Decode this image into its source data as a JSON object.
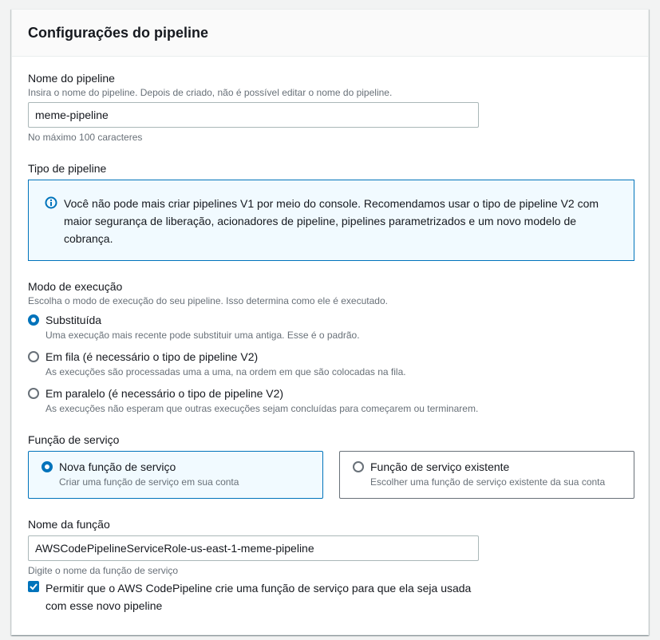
{
  "panel": {
    "title": "Configurações do pipeline"
  },
  "pipeline_name": {
    "label": "Nome do pipeline",
    "description": "Insira o nome do pipeline. Depois de criado, não é possível editar o nome do pipeline.",
    "value": "meme-pipeline",
    "constraint": "No máximo 100 caracteres"
  },
  "pipeline_type": {
    "label": "Tipo de pipeline",
    "info_text": "Você não pode mais criar pipelines V1 por meio do console. Recomendamos usar o tipo de pipeline V2 com maior segurança de liberação, acionadores de pipeline, pipelines parametrizados e um novo modelo de cobrança."
  },
  "execution_mode": {
    "label": "Modo de execução",
    "description": "Escolha o modo de execução do seu pipeline. Isso determina como ele é executado.",
    "options": [
      {
        "label": "Substituída",
        "description": "Uma execução mais recente pode substituir uma antiga. Esse é o padrão.",
        "selected": true
      },
      {
        "label": "Em fila (é necessário o tipo de pipeline V2)",
        "description": "As execuções são processadas uma a uma, na ordem em que são colocadas na fila.",
        "selected": false
      },
      {
        "label": "Em paralelo (é necessário o tipo de pipeline V2)",
        "description": "As execuções não esperam que outras execuções sejam concluídas para começarem ou terminarem.",
        "selected": false
      }
    ]
  },
  "service_role": {
    "label": "Função de serviço",
    "tiles": [
      {
        "label": "Nova função de serviço",
        "description": "Criar uma função de serviço em sua conta",
        "selected": true
      },
      {
        "label": "Função de serviço existente",
        "description": "Escolher uma função de serviço existente da sua conta",
        "selected": false
      }
    ]
  },
  "role_name": {
    "label": "Nome da função",
    "value": "AWSCodePipelineServiceRole-us-east-1-meme-pipeline",
    "hint": "Digite o nome da função de serviço"
  },
  "permission_checkbox": {
    "checked": true,
    "label_line1": "Permitir que o AWS CodePipeline crie uma função de serviço para que ela seja usada",
    "label_line2": "com esse novo pipeline"
  },
  "colors": {
    "accent": "#0073bb",
    "info_bg": "#f1faff",
    "text": "#16191f",
    "muted": "#687078"
  }
}
